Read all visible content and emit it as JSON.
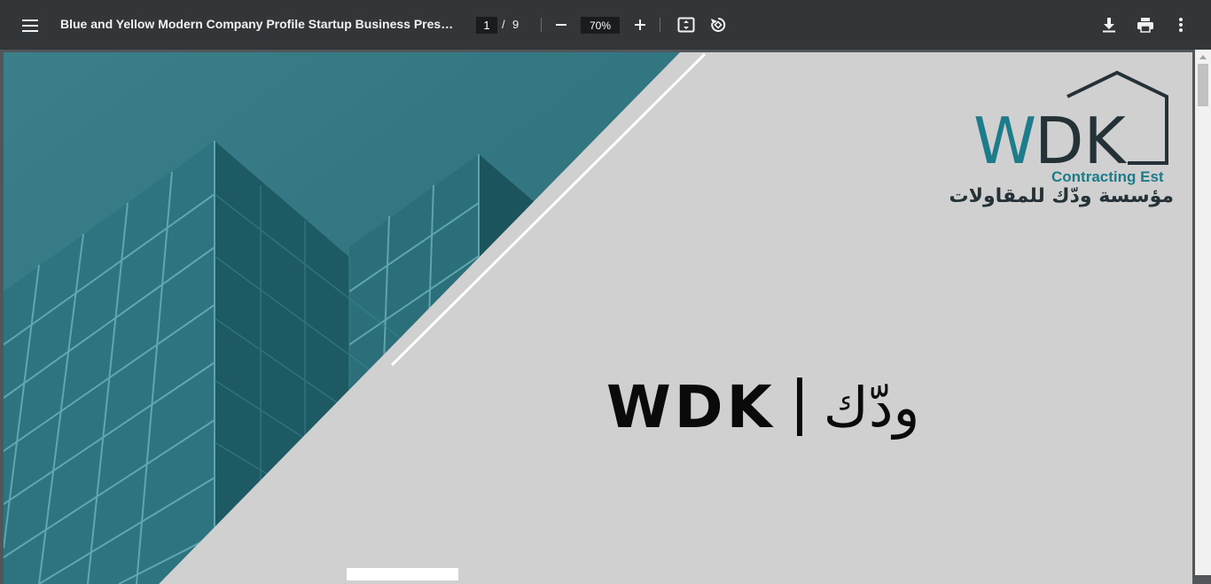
{
  "toolbar": {
    "menu_icon": "hamburger-menu-icon",
    "title": "Blue and Yellow Modern Company Profile Startup Business Presentati...",
    "current_page": "1",
    "page_separator": "/",
    "total_pages": "9",
    "zoom_level": "70%",
    "icons": {
      "zoom_out": "minus-icon",
      "zoom_in": "plus-icon",
      "fit": "fit-to-page-icon",
      "rotate": "rotate-icon",
      "download": "download-icon",
      "print": "print-icon",
      "more": "more-vert-icon"
    }
  },
  "slide": {
    "logo": {
      "mark": "WDK",
      "subtitle": "Contracting Est",
      "arabic": "مؤسسة ودّك للمقاولات"
    },
    "headline": {
      "latin": "WDK",
      "arabic": "ودّك"
    }
  },
  "colors": {
    "toolbar_bg": "#323639",
    "viewer_bg": "#525659",
    "slide_bg": "#d0d0d0",
    "teal": "#2f7580",
    "logo_teal": "#1c7c8a",
    "logo_dark": "#243238"
  }
}
